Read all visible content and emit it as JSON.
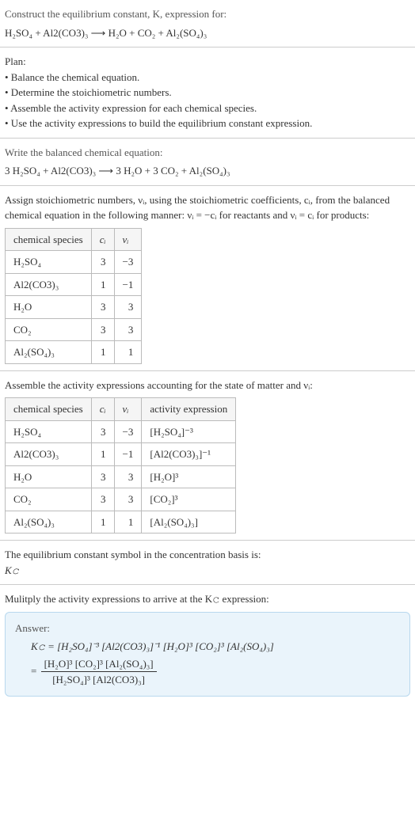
{
  "s1": {
    "prompt": "Construct the equilibrium constant, K, expression for:",
    "equation": "H₂SO₄ + Al2(CO3)₃ ⟶ H₂O + CO₂ + Al₂(SO₄)₃"
  },
  "s2": {
    "heading": "Plan:",
    "b1": "• Balance the chemical equation.",
    "b2": "• Determine the stoichiometric numbers.",
    "b3": "• Assemble the activity expression for each chemical species.",
    "b4": "• Use the activity expressions to build the equilibrium constant expression."
  },
  "s3": {
    "prompt": "Write the balanced chemical equation:",
    "equation": "3 H₂SO₄ + Al2(CO3)₃ ⟶ 3 H₂O + 3 CO₂ + Al₂(SO₄)₃"
  },
  "s4": {
    "text": "Assign stoichiometric numbers, νᵢ, using the stoichiometric coefficients, cᵢ, from the balanced chemical equation in the following manner: νᵢ = −cᵢ for reactants and νᵢ = cᵢ for products:",
    "th1": "chemical species",
    "th2": "cᵢ",
    "th3": "νᵢ",
    "r1c1": "H₂SO₄",
    "r1c2": "3",
    "r1c3": "−3",
    "r2c1": "Al2(CO3)₃",
    "r2c2": "1",
    "r2c3": "−1",
    "r3c1": "H₂O",
    "r3c2": "3",
    "r3c3": "3",
    "r4c1": "CO₂",
    "r4c2": "3",
    "r4c3": "3",
    "r5c1": "Al₂(SO₄)₃",
    "r5c2": "1",
    "r5c3": "1"
  },
  "s5": {
    "text": "Assemble the activity expressions accounting for the state of matter and νᵢ:",
    "th1": "chemical species",
    "th2": "cᵢ",
    "th3": "νᵢ",
    "th4": "activity expression",
    "r1c1": "H₂SO₄",
    "r1c2": "3",
    "r1c3": "−3",
    "r1c4": "[H₂SO₄]⁻³",
    "r2c1": "Al2(CO3)₃",
    "r2c2": "1",
    "r2c3": "−1",
    "r2c4": "[Al2(CO3)₃]⁻¹",
    "r3c1": "H₂O",
    "r3c2": "3",
    "r3c3": "3",
    "r3c4": "[H₂O]³",
    "r4c1": "CO₂",
    "r4c2": "3",
    "r4c3": "3",
    "r4c4": "[CO₂]³",
    "r5c1": "Al₂(SO₄)₃",
    "r5c2": "1",
    "r5c3": "1",
    "r5c4": "[Al₂(SO₄)₃]"
  },
  "s6": {
    "text": "The equilibrium constant symbol in the concentration basis is:",
    "symbol": "K𝚌"
  },
  "s7": {
    "text": "Mulitply the activity expressions to arrive at the K𝚌 expression:",
    "answerLabel": "Answer:",
    "line1": "K𝚌 = [H₂SO₄]⁻³ [Al2(CO3)₃]⁻¹ [H₂O]³ [CO₂]³ [Al₂(SO₄)₃]",
    "eq": "= ",
    "fracNum": "[H₂O]³ [CO₂]³ [Al₂(SO₄)₃]",
    "fracDen": "[H₂SO₄]³ [Al2(CO3)₃]"
  },
  "chart_data": {
    "type": "table",
    "title": "Stoichiometric numbers and activity expressions",
    "columns": [
      "chemical species",
      "cᵢ",
      "νᵢ",
      "activity expression"
    ],
    "rows": [
      [
        "H₂SO₄",
        3,
        -3,
        "[H₂SO₄]⁻³"
      ],
      [
        "Al2(CO3)₃",
        1,
        -1,
        "[Al2(CO3)₃]⁻¹"
      ],
      [
        "H₂O",
        3,
        3,
        "[H₂O]³"
      ],
      [
        "CO₂",
        3,
        3,
        "[CO₂]³"
      ],
      [
        "Al₂(SO₄)₃",
        1,
        1,
        "[Al₂(SO₄)₃]"
      ]
    ]
  }
}
